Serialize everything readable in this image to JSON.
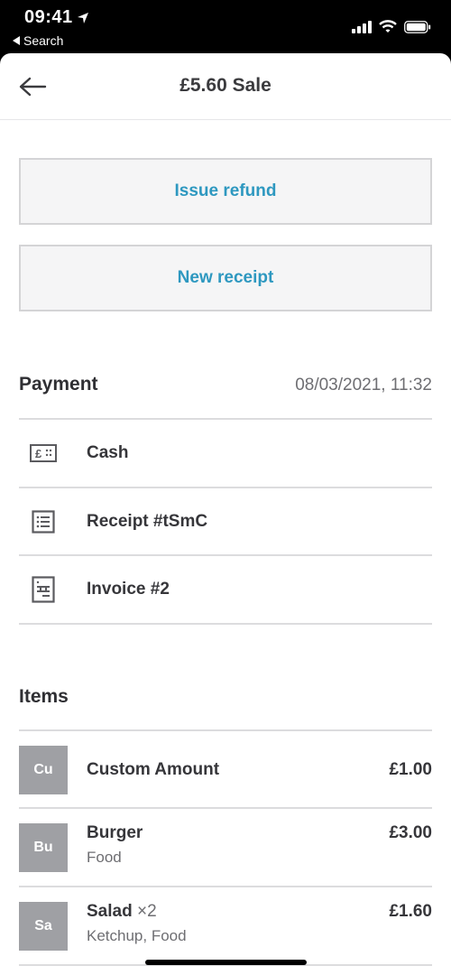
{
  "status_bar": {
    "time": "09:41",
    "back_app_label": "Search"
  },
  "nav": {
    "title": "£5.60 Sale"
  },
  "actions": {
    "issue_refund_label": "Issue refund",
    "new_receipt_label": "New receipt"
  },
  "payment": {
    "title": "Payment",
    "datetime": "08/03/2021, 11:32",
    "rows": [
      {
        "icon": "cash-icon",
        "label": "Cash"
      },
      {
        "icon": "receipt-icon",
        "label": "Receipt #tSmC"
      },
      {
        "icon": "invoice-icon",
        "label": "Invoice #2"
      }
    ]
  },
  "items": {
    "title": "Items",
    "rows": [
      {
        "initials": "Cu",
        "name": "Custom Amount",
        "quantity": "",
        "subtitle": "",
        "price": "£1.00"
      },
      {
        "initials": "Bu",
        "name": "Burger",
        "quantity": "",
        "subtitle": "Food",
        "price": "£3.00"
      },
      {
        "initials": "Sa",
        "name": "Salad",
        "quantity": "×2",
        "subtitle": "Ketchup, Food",
        "price": "£1.60"
      }
    ]
  },
  "colors": {
    "accent": "#2e98c0",
    "tile": "#9fa0a4",
    "text_primary": "#36363a",
    "text_secondary": "#6e6e72"
  }
}
